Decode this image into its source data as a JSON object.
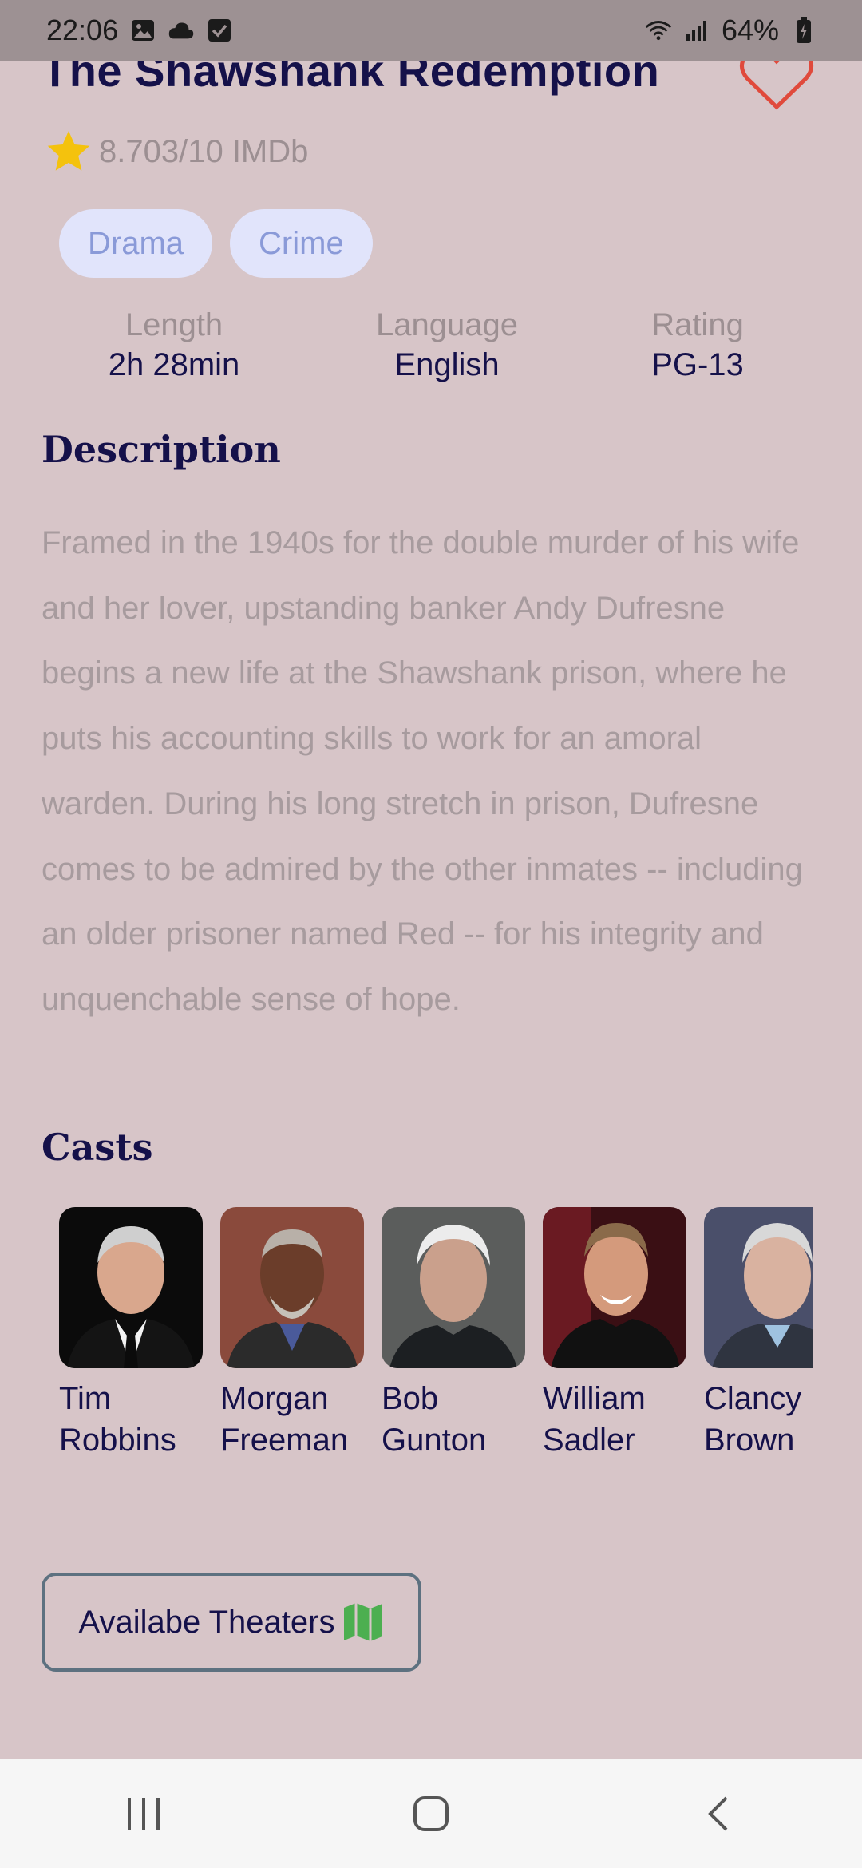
{
  "status_bar": {
    "time": "22:06",
    "battery": "64%",
    "icons": [
      "gallery-icon",
      "cloud-icon",
      "checkbox-icon",
      "wifi-icon",
      "signal-icon",
      "battery-icon"
    ]
  },
  "movie": {
    "title": "The Shawshank Redemption",
    "rating": "8.703/10 IMDb",
    "genres": [
      "Drama",
      "Crime"
    ],
    "stats": [
      {
        "label": "Length",
        "value": "2h 28min"
      },
      {
        "label": "Language",
        "value": "English"
      },
      {
        "label": "Rating",
        "value": "PG-13"
      }
    ]
  },
  "description": {
    "heading": "Description",
    "text": "Framed in the 1940s for the double murder of his wife and her lover, upstanding banker Andy Dufresne begins a new life at the Shawshank prison, where he puts his accounting skills to work for an amoral warden. During his long stretch in prison, Dufresne comes to be admired by the other inmates -- including an older prisoner named Red -- for his integrity and unquenchable sense of hope."
  },
  "casts": {
    "heading": "Casts",
    "items": [
      {
        "first": "Tim",
        "last": "Robbins"
      },
      {
        "first": "Morgan",
        "last": "Freeman"
      },
      {
        "first": "Bob",
        "last": "Gunton"
      },
      {
        "first": "William",
        "last": "Sadler"
      },
      {
        "first": "Clancy",
        "last": "Brown"
      }
    ]
  },
  "theaters_button": {
    "label": "Availabe Theaters"
  },
  "colors": {
    "background": "#d7c5c8",
    "title": "#15114a",
    "muted": "#9c8f92",
    "chip_bg": "#e1e4fb",
    "chip_text": "#8a9ad8",
    "heart": "#e04a3c",
    "star": "#f4c20d",
    "map_icon": "#4caf50"
  }
}
